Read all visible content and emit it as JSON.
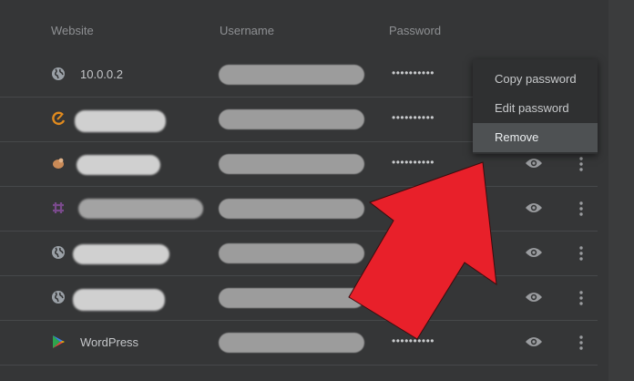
{
  "table": {
    "headers": {
      "website": "Website",
      "username": "Username",
      "password": "Password"
    },
    "rows": [
      {
        "site": "10.0.0.2",
        "icon": "globe-icon",
        "password_mask": "••••••••••"
      },
      {
        "site": "",
        "icon": "site-favicon-orange",
        "password_mask": "••••••••••"
      },
      {
        "site": "",
        "icon": "site-favicon-brown",
        "password_mask": "••••••••••"
      },
      {
        "site": "",
        "icon": "site-favicon-purple",
        "password_mask": "••••••••••"
      },
      {
        "site": "",
        "icon": "globe-icon",
        "password_mask": "••••••••••"
      },
      {
        "site": "",
        "icon": "globe-icon",
        "password_mask": "••••••••••"
      },
      {
        "site": "WordPress",
        "icon": "google-play-icon",
        "password_mask": "••••••••••"
      }
    ]
  },
  "context_menu": {
    "copy": "Copy password",
    "edit": "Edit password",
    "remove": "Remove"
  },
  "colors": {
    "background": "#353637",
    "menu_bg": "#2f3031",
    "menu_active": "#4e5153",
    "arrow": "#e8202a"
  }
}
